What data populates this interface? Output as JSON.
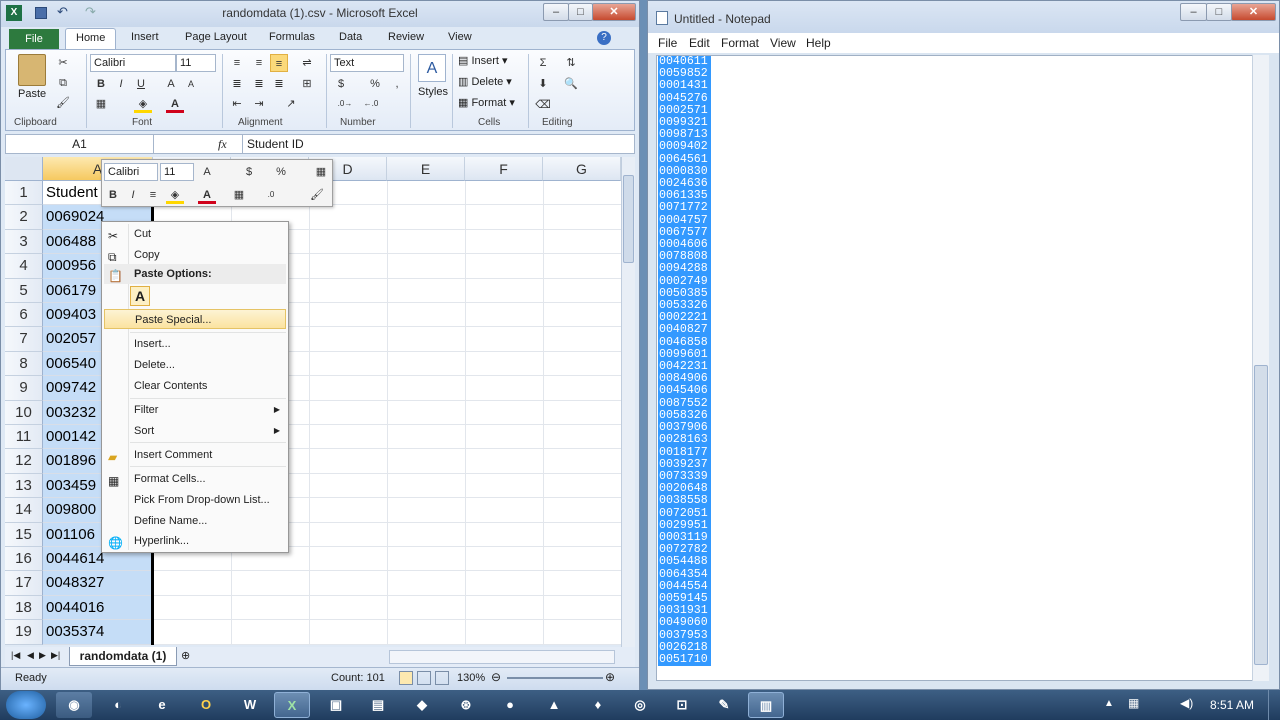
{
  "excel": {
    "title": "randomdata (1).csv - Microsoft Excel",
    "tabs": [
      "File",
      "Home",
      "Insert",
      "Page Layout",
      "Formulas",
      "Data",
      "Review",
      "View"
    ],
    "font_name": "Calibri",
    "font_size": "11",
    "number_format": "Text",
    "groups": {
      "clipboard": "Clipboard",
      "font": "Font",
      "alignment": "Alignment",
      "number": "Number",
      "cells": "Cells",
      "editing": "Editing",
      "styles": "Styles"
    },
    "paste_label": "Paste",
    "cells_buttons": [
      "Insert",
      "Delete",
      "Format"
    ],
    "name_box": "A1",
    "fx": "fx",
    "formula": "Student ID",
    "columns": [
      "A",
      "B",
      "C",
      "D",
      "E",
      "F",
      "G"
    ],
    "rows": [
      {
        "n": "1",
        "v": "Student"
      },
      {
        "n": "2",
        "v": "0069024"
      },
      {
        "n": "3",
        "v": "006488"
      },
      {
        "n": "4",
        "v": "000956"
      },
      {
        "n": "5",
        "v": "006179"
      },
      {
        "n": "6",
        "v": "009403"
      },
      {
        "n": "7",
        "v": "002057"
      },
      {
        "n": "8",
        "v": "006540"
      },
      {
        "n": "9",
        "v": "009742"
      },
      {
        "n": "10",
        "v": "003232"
      },
      {
        "n": "11",
        "v": "000142"
      },
      {
        "n": "12",
        "v": "001896"
      },
      {
        "n": "13",
        "v": "003459"
      },
      {
        "n": "14",
        "v": "009800"
      },
      {
        "n": "15",
        "v": "001106"
      },
      {
        "n": "16",
        "v": "0044614"
      },
      {
        "n": "17",
        "v": "0048327"
      },
      {
        "n": "18",
        "v": "0044016"
      },
      {
        "n": "19",
        "v": "0035374"
      }
    ],
    "mini": {
      "font": "Calibri",
      "size": "11"
    },
    "sheet_tab": "randomdata (1)",
    "status_ready": "Ready",
    "status_count": "Count: 101",
    "zoom": "130%"
  },
  "context_menu": {
    "items": [
      "Cut",
      "Copy",
      "Paste Options:",
      "Paste Special...",
      "Insert...",
      "Delete...",
      "Clear Contents",
      "Filter",
      "Sort",
      "Insert Comment",
      "Format Cells...",
      "Pick From Drop-down List...",
      "Define Name...",
      "Hyperlink..."
    ],
    "paste_icon": "A"
  },
  "notepad": {
    "title": "Untitled - Notepad",
    "menu": [
      "File",
      "Edit",
      "Format",
      "View",
      "Help"
    ],
    "lines": [
      "0040611",
      "0059852",
      "0001431",
      "0045276",
      "0002571",
      "0099321",
      "0098713",
      "0009402",
      "0064561",
      "0000830",
      "0024636",
      "0061335",
      "0071772",
      "0004757",
      "0067577",
      "0004606",
      "0078808",
      "0094288",
      "0002749",
      "0050385",
      "0053326",
      "0002221",
      "0040827",
      "0046858",
      "0099601",
      "0042231",
      "0084906",
      "0045406",
      "0087552",
      "0058326",
      "0037906",
      "0028163",
      "0018177",
      "0039237",
      "0073339",
      "0020648",
      "0038558",
      "0072051",
      "0029951",
      "0003119",
      "0072782",
      "0054488",
      "0064354",
      "0044554",
      "0059145",
      "0031931",
      "0049060",
      "0037953",
      "0026218",
      "0051710"
    ]
  },
  "taskbar": {
    "time": "8:51 AM",
    "apps": [
      "W",
      "X",
      "O"
    ]
  }
}
